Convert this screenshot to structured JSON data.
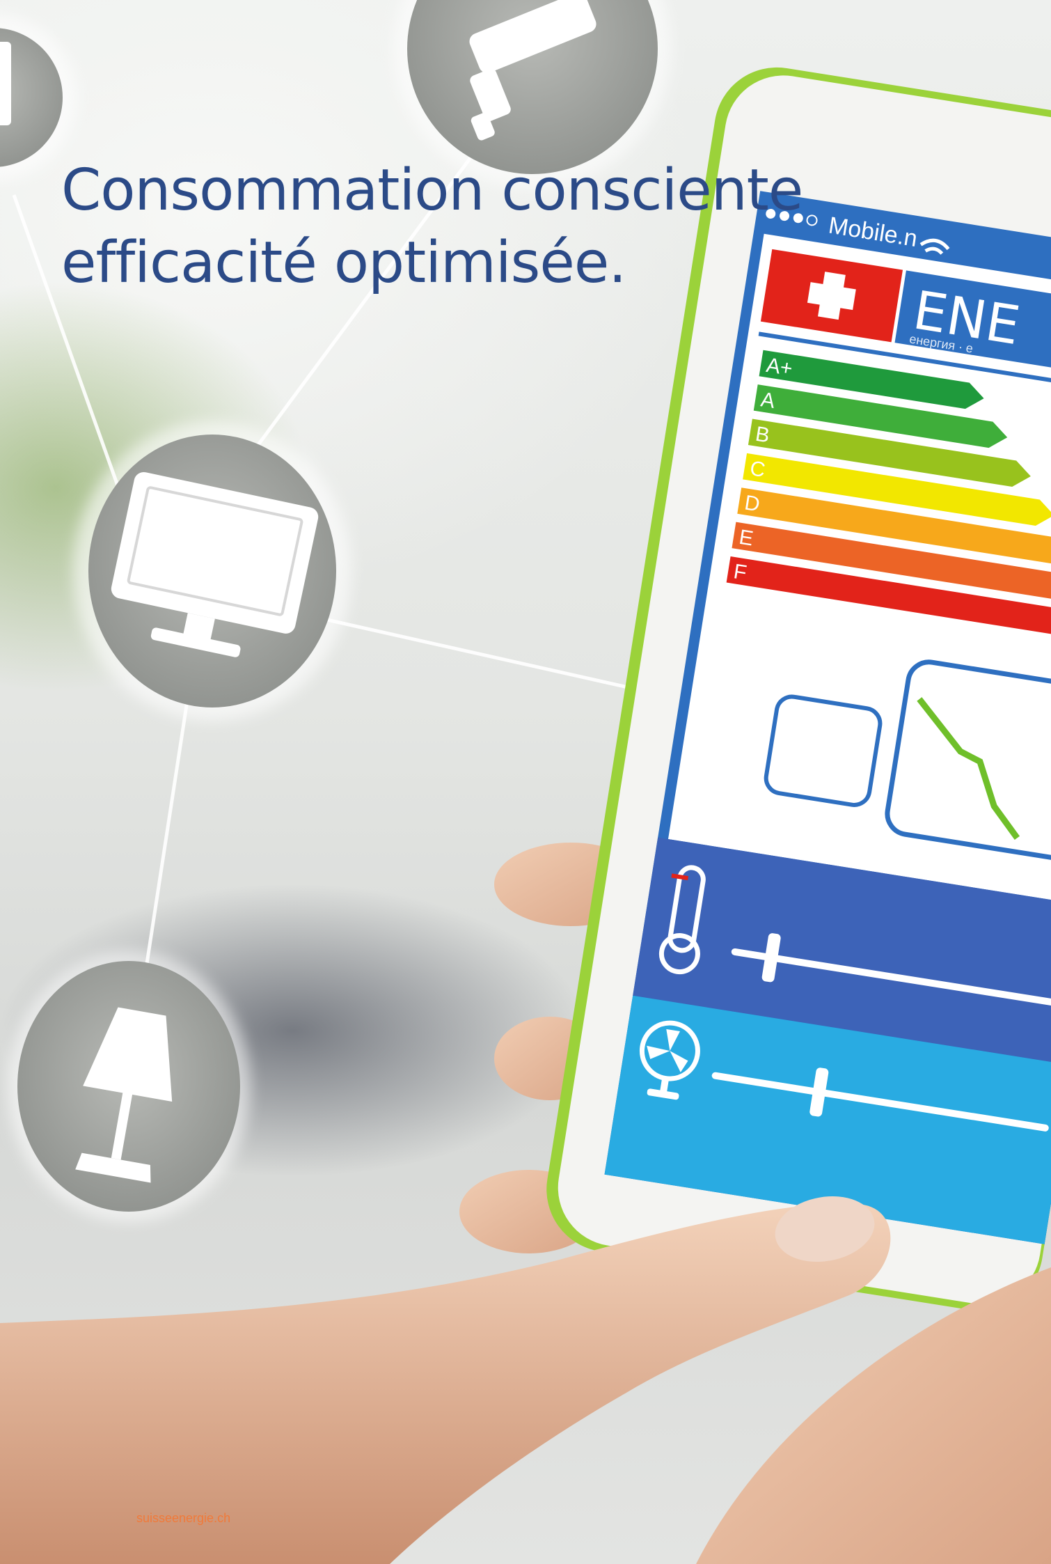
{
  "headline": {
    "line1": "Consommation consciente",
    "line2": "efficacité optimisée."
  },
  "phone": {
    "carrier": "Mobile.n",
    "label_brand": "ENE",
    "label_subtitle": "енергия · e",
    "energy_classes": [
      "A+",
      "A",
      "B",
      "C",
      "D",
      "E",
      "F"
    ],
    "energy_colors": [
      "#1f9a3c",
      "#3fae3a",
      "#98c21d",
      "#f2e700",
      "#f7a81b",
      "#ec6426",
      "#e2231a"
    ],
    "temperature_slider_level": 0.1,
    "fan_slider_level": 0.3
  },
  "network_icons": [
    "monitor-icon",
    "lamp-icon",
    "security-camera-icon",
    "appliance-icon"
  ],
  "footer": {
    "url": "suisseenergie.ch"
  },
  "colors": {
    "headline": "#2b4a87",
    "accent_blue": "#2e6fc0",
    "phone_frame_green": "#9bd23a",
    "footer": "#f07a3a"
  }
}
